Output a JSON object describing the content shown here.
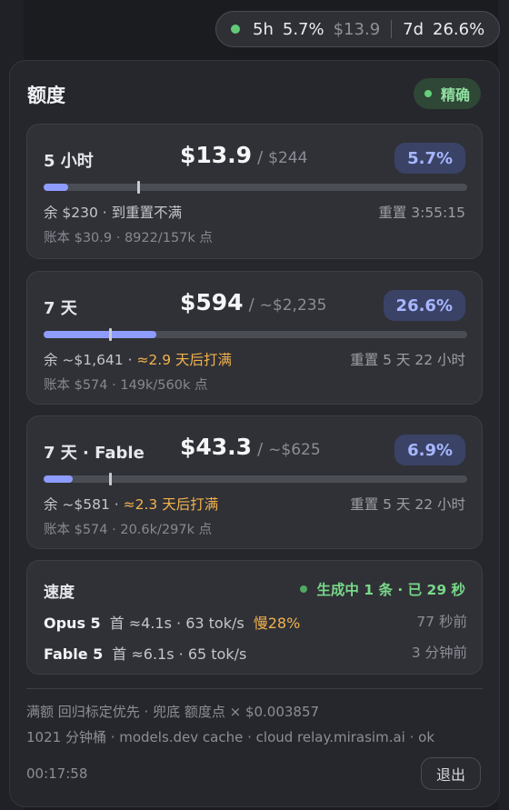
{
  "status_pill": {
    "win1_label": "5h",
    "win1_pct": "5.7%",
    "win1_amount": "$13.9",
    "win2_label": "7d",
    "win2_pct": "26.6%"
  },
  "panel": {
    "title": "额度",
    "accuracy_label": "精确"
  },
  "cards": [
    {
      "name": "5 小时",
      "used": "$13.9",
      "sep": "/",
      "cap": "$244",
      "pct": "5.7%",
      "fill": 0.057,
      "marker": 0.22,
      "left": "余 $230 · 到重置不满",
      "left_warn": "",
      "right": "重置 3:55:15",
      "sub": "账本 $30.9 · 8922/157k 点"
    },
    {
      "name": "7 天",
      "used": "$594",
      "sep": "/",
      "cap": "~$2,235",
      "pct": "26.6%",
      "fill": 0.266,
      "marker": 0.155,
      "left": "余 ~$1,641 · ",
      "left_warn": "≈2.9 天后打满",
      "right": "重置 5 天 22 小时",
      "sub": "账本 $574 · 149k/560k 点"
    },
    {
      "name": "7 天 · Fable",
      "used": "$43.3",
      "sep": "/",
      "cap": "~$625",
      "pct": "6.9%",
      "fill": 0.069,
      "marker": 0.155,
      "left": "余 ~$581 · ",
      "left_warn": "≈2.3 天后打满",
      "right": "重置 5 天 22 小时",
      "sub": "账本 $574 · 20.6k/297k 点"
    }
  ],
  "speed": {
    "title": "速度",
    "status": "生成中 1 条 · 已 29 秒",
    "rows": [
      {
        "model": "Opus 5",
        "stats": "首 ≈4.1s · 63 tok/s",
        "slow": "慢28%",
        "ago": "77 秒前"
      },
      {
        "model": "Fable 5",
        "stats": "首 ≈6.1s · 65 tok/s",
        "slow": "",
        "ago": "3 分钟前"
      }
    ]
  },
  "footer": {
    "line1": "满额 回归标定优先 · 兜底 额度点 × $0.003857",
    "line2": "1021 分钟桶 · models.dev cache · cloud relay.mirasim.ai · ok",
    "clock": "00:17:58",
    "logout_label": "退出"
  },
  "colors": {
    "accent": "#8e9cff",
    "ok": "#66d07d",
    "warn": "#f2b24c"
  }
}
